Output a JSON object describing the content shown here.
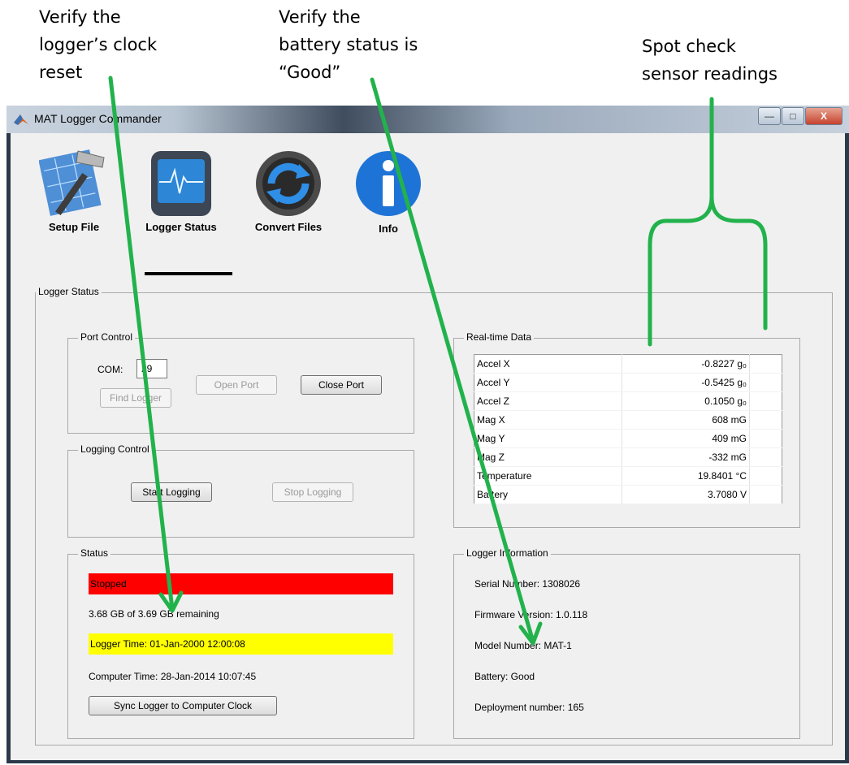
{
  "callouts": {
    "clock": [
      "Verify the",
      "logger’s clock",
      "reset"
    ],
    "battery": [
      "Verify the",
      "battery status is",
      "“Good”"
    ],
    "sensors": [
      "Spot check",
      "sensor readings"
    ]
  },
  "window": {
    "title": "MAT Logger Commander",
    "controls": {
      "minimize": "—",
      "maximize": "□",
      "close": "X"
    }
  },
  "toolbar": {
    "setup": "Setup File",
    "status": "Logger Status",
    "convert": "Convert Files",
    "info": "Info"
  },
  "panel_title": "Logger Status",
  "port_control": {
    "title": "Port Control",
    "com_label": "COM:",
    "com_value": "29",
    "open_port": "Open Port",
    "close_port": "Close Port",
    "find_logger": "Find Logger"
  },
  "logging_control": {
    "title": "Logging Control",
    "start": "Start Logging",
    "stop": "Stop Logging"
  },
  "status": {
    "title": "Status",
    "state": "Stopped",
    "storage": "3.68 GB of 3.69 GB remaining",
    "logger_time": "Logger Time: 01-Jan-2000 12:00:08",
    "computer_time": "Computer Time: 28-Jan-2014 10:07:45",
    "sync": "Sync Logger to Computer Clock"
  },
  "realtime": {
    "title": "Real-time Data",
    "rows": [
      {
        "name": "Accel X",
        "value": "-0.8227 g₀"
      },
      {
        "name": "Accel Y",
        "value": "-0.5425 g₀"
      },
      {
        "name": "Accel Z",
        "value": "0.1050 g₀"
      },
      {
        "name": "Mag X",
        "value": "608 mG"
      },
      {
        "name": "Mag Y",
        "value": "409 mG"
      },
      {
        "name": "Mag Z",
        "value": "-332 mG"
      },
      {
        "name": "Temperature",
        "value": "19.8401 °C"
      },
      {
        "name": "Battery",
        "value": "3.7080 V"
      }
    ]
  },
  "logger_info": {
    "title": "Logger Information",
    "serial": "Serial Number: 1308026",
    "firmware": "Firmware Version: 1.0.118",
    "model": "Model Number: MAT-1",
    "battery": "Battery: Good",
    "deployment": "Deployment number: 165"
  },
  "colors": {
    "stopped": "#ff0000",
    "logger_time_highlight": "#ffff00",
    "annotation": "#22b24c"
  }
}
